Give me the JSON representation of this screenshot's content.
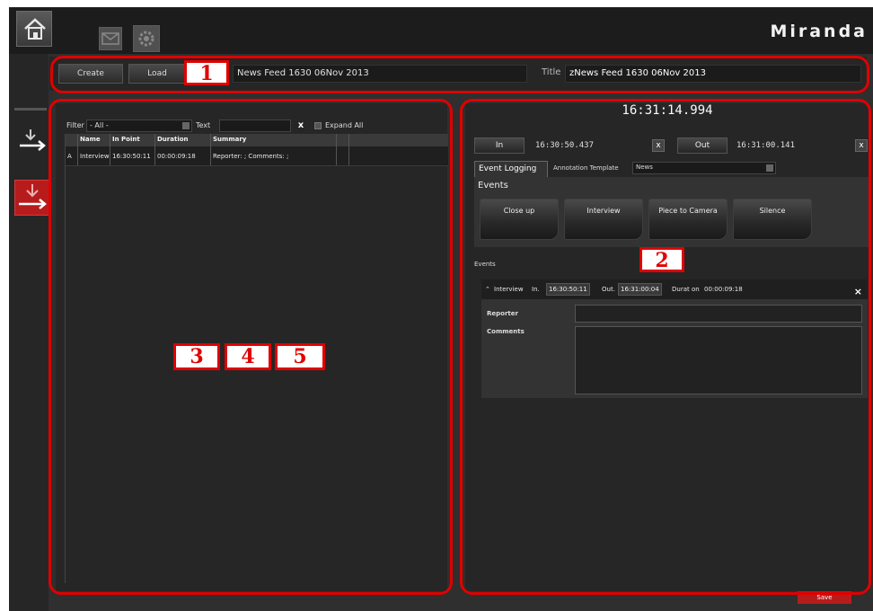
{
  "app": {
    "logo": "Miranda",
    "icons": [
      "home-icon",
      "mail-icon",
      "gear-icon"
    ]
  },
  "toolbar": {
    "create_label": "Create",
    "load_label": "Load",
    "feed_name": "News Feed 1630 06Nov 2013",
    "title_label": "Title",
    "title_value": "zNews Feed 1630 06Nov 2013"
  },
  "left_panel": {
    "filter_label": "Filter",
    "filter_value": "- All -",
    "text_label": "Text",
    "clear_label": "x",
    "expand_all_label": "Expand All",
    "columns": [
      "",
      "Name",
      "In Point",
      "Duration",
      "Summary",
      "",
      ""
    ],
    "rows": [
      [
        "A",
        "Interview",
        "16:30:50:11",
        "00:00:09:18",
        "Reporter: ; Comments: ;",
        "",
        ""
      ]
    ]
  },
  "right_panel": {
    "timecode": "16:31:14.994",
    "in_label": "In",
    "in_time": "16:30:50.437",
    "in_clear": "x",
    "out_label": "Out",
    "out_time": "16:31:00.141",
    "out_clear": "x",
    "tab_event_logging": "Event Logging",
    "annotation_template_label": "Annotation Template",
    "annotation_template_value": "News",
    "events_title": "Events",
    "event_buttons": [
      "Close up",
      "Interview",
      "Piece to Camera",
      "Silence"
    ],
    "events_list_title": "Events",
    "event": {
      "name": "Interview",
      "in_label": "In.",
      "in_value": "16:30:50:11",
      "out_label": "Out.",
      "out_value": "16:31:00:04",
      "duration_label": "Durat on",
      "duration_value": "00:00:09:18",
      "close": "×",
      "reporter_label": "Reporter",
      "comments_label": "Comments"
    }
  },
  "footer": {
    "save_label": "Save"
  },
  "annotations": [
    "1",
    "2",
    "3",
    "4",
    "5"
  ],
  "colors": {
    "accent_red": "#e00000",
    "rail_red": "#b71c1c",
    "background": "#2f2f2f"
  }
}
